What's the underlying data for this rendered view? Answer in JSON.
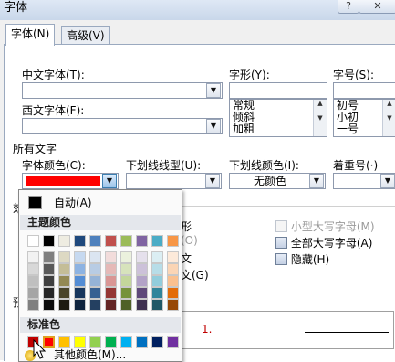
{
  "window": {
    "title": "字体",
    "help_button": "?",
    "close_button": "✕"
  },
  "tabs": [
    "字体(N)",
    "高级(V)"
  ],
  "fields": {
    "chinese_font_label": "中文字体(T):",
    "western_font_label": "西文字体(F):",
    "style_label": "字形(Y):",
    "style_options": [
      "常规",
      "倾斜",
      "加粗"
    ],
    "size_label": "字号(S):",
    "size_options": [
      "初号",
      "小初",
      "一号"
    ]
  },
  "all_text": {
    "section_label": "所有文字",
    "font_color_label": "字体颜色(C):",
    "font_color_value": "#ff0000",
    "underline_type_label": "下划线线型(U):",
    "underline_color_label": "下划线颜色(I):",
    "underline_color_value": "无颜色",
    "emphasis_label": "着重号(·)"
  },
  "effects": {
    "section_label_partial": "效",
    "left_partial": [
      "形",
      "(O)",
      "文",
      "文(G)"
    ],
    "small_caps": "小型大写字母(M)",
    "all_caps": "全部大写字母(A)",
    "hidden": "隐藏(H)"
  },
  "preview": {
    "label_partial": "预",
    "marker": "1."
  },
  "color_popup": {
    "auto_label": "自动(A)",
    "theme_header": "主题颜色",
    "standard_header": "标准色",
    "more_colors": "其他颜色(M)...",
    "theme_top": [
      "#ffffff",
      "#000000",
      "#eeece1",
      "#1f497d",
      "#4f81bd",
      "#c0504d",
      "#9bbb59",
      "#8064a2",
      "#4bacc6",
      "#f79646"
    ],
    "theme_shades": [
      [
        "#f2f2f2",
        "#7f7f7f",
        "#ddd9c3",
        "#c6d9f0",
        "#dbe5f1",
        "#f2dcdb",
        "#ebf1dd",
        "#e5e0ec",
        "#dbeef3",
        "#fdeada"
      ],
      [
        "#d8d8d8",
        "#595959",
        "#c4bd97",
        "#8db3e2",
        "#b8cce4",
        "#e5b9b7",
        "#d7e3bc",
        "#ccc1d9",
        "#b7dde8",
        "#fbd5b5"
      ],
      [
        "#bfbfbf",
        "#3f3f3f",
        "#938953",
        "#548dd4",
        "#95b3d7",
        "#d99694",
        "#c3d69b",
        "#b2a2c7",
        "#92cddc",
        "#fac08f"
      ],
      [
        "#a5a5a5",
        "#262626",
        "#494429",
        "#17365d",
        "#366092",
        "#953734",
        "#76923c",
        "#5f497a",
        "#31859b",
        "#e36c09"
      ],
      [
        "#7f7f7f",
        "#0c0c0c",
        "#1d1b10",
        "#0f243e",
        "#244061",
        "#632423",
        "#4f6128",
        "#3f3151",
        "#205867",
        "#974806"
      ]
    ],
    "standard": [
      "#c00000",
      "#ff0000",
      "#ffc000",
      "#ffff00",
      "#92d050",
      "#00b050",
      "#00b0f0",
      "#0070c0",
      "#002060",
      "#7030a0"
    ]
  }
}
